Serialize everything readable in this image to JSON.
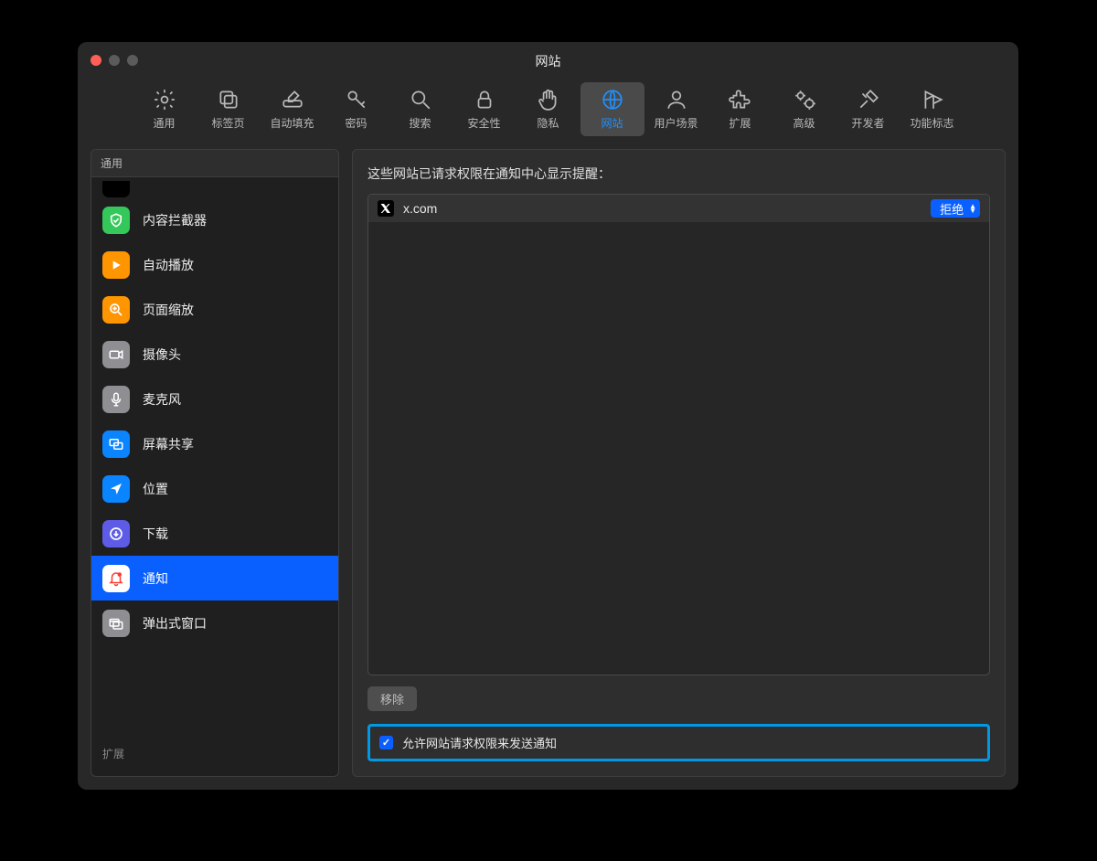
{
  "window": {
    "title": "网站"
  },
  "toolbar": [
    {
      "id": "general",
      "label": "通用"
    },
    {
      "id": "tabs",
      "label": "标签页"
    },
    {
      "id": "autofill",
      "label": "自动填充"
    },
    {
      "id": "passwords",
      "label": "密码"
    },
    {
      "id": "search",
      "label": "搜索"
    },
    {
      "id": "security",
      "label": "安全性"
    },
    {
      "id": "privacy",
      "label": "隐私"
    },
    {
      "id": "websites",
      "label": "网站",
      "active": true
    },
    {
      "id": "profiles",
      "label": "用户场景"
    },
    {
      "id": "extensions",
      "label": "扩展"
    },
    {
      "id": "advanced",
      "label": "高级"
    },
    {
      "id": "developer",
      "label": "开发者"
    },
    {
      "id": "flags",
      "label": "功能标志"
    }
  ],
  "sidebar": {
    "header": "通用",
    "items": [
      {
        "id": "truncated",
        "label": "",
        "color": "#000000"
      },
      {
        "id": "blockers",
        "label": "内容拦截器",
        "color": "#34c759"
      },
      {
        "id": "autoplay",
        "label": "自动播放",
        "color": "#ff9500"
      },
      {
        "id": "zoom",
        "label": "页面缩放",
        "color": "#ff9500"
      },
      {
        "id": "camera",
        "label": "摄像头",
        "color": "#8e8e93"
      },
      {
        "id": "microphone",
        "label": "麦克风",
        "color": "#8e8e93"
      },
      {
        "id": "screenshare",
        "label": "屏幕共享",
        "color": "#0a84ff"
      },
      {
        "id": "location",
        "label": "位置",
        "color": "#0a84ff"
      },
      {
        "id": "downloads",
        "label": "下载",
        "color": "#5e5ce6"
      },
      {
        "id": "notifications",
        "label": "通知",
        "color": "#ffffff",
        "selected": true
      },
      {
        "id": "popups",
        "label": "弹出式窗口",
        "color": "#8e8e93"
      }
    ],
    "footer": "扩展"
  },
  "main": {
    "heading": "这些网站已请求权限在通知中心显示提醒：",
    "rows": [
      {
        "site": "x.com",
        "value": "拒绝"
      }
    ],
    "remove_label": "移除",
    "checkbox_label": "允许网站请求权限来发送通知",
    "checkbox_checked": true
  },
  "help_glyph": "?"
}
